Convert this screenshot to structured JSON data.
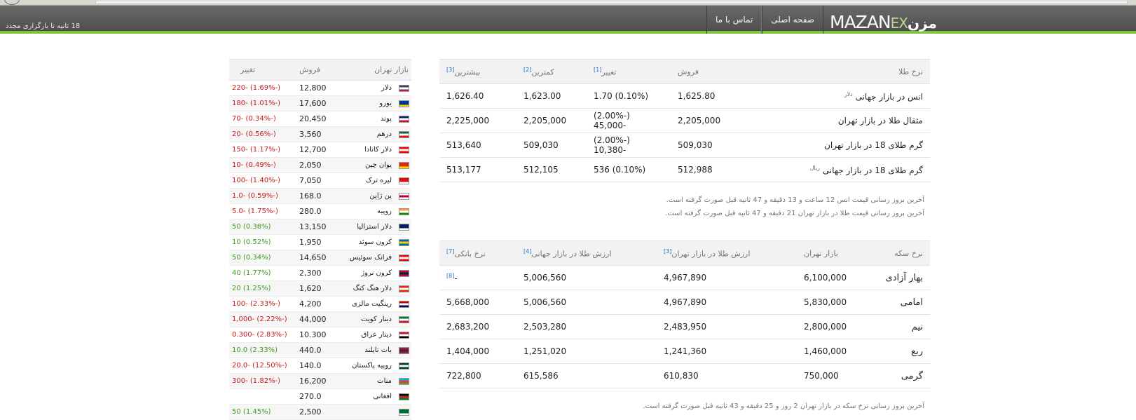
{
  "header": {
    "reload_text": "18 ثانیه تا بارگزاری مجدد",
    "logo": {
      "part1": "MAZAN",
      "part2": "EX",
      "part3": "مزن"
    },
    "nav": [
      {
        "label": "صفحه اصلی"
      },
      {
        "label": "تماس با ما"
      }
    ],
    "colors": {
      "bar": "#5a5a5a",
      "accent": "#7ec33d"
    }
  },
  "gold_table": {
    "headers": {
      "name": "نرخ طلا",
      "sell": "فروش",
      "change": "تغییر",
      "change_ref": "[1]",
      "min": "کمترین",
      "min_ref": "[2]",
      "max": "بیشترین",
      "max_ref": "[3]"
    },
    "rows": [
      {
        "name": "انس در بازار جهانی",
        "unit": "دلار",
        "sell": "1,625.80",
        "change": "(0.10%) 1.70",
        "dir": "pos",
        "min": "1,623.00",
        "max": "1,626.40"
      },
      {
        "name": "مثقال طلا در بازار تهران",
        "unit": "",
        "sell": "2,205,000",
        "change": "(-2.00%) -45,000",
        "dir": "neg",
        "min": "2,205,000",
        "max": "2,225,000"
      },
      {
        "name": "گرم طلای 18 در بازار تهران",
        "unit": "",
        "sell": "509,030",
        "change": "(-2.00%) -10,380",
        "dir": "neg",
        "min": "509,030",
        "max": "513,640"
      },
      {
        "name": "گرم طلای 18 در بازار جهانی",
        "unit": "ریال",
        "sell": "512,988",
        "change": "(0.10%) 536",
        "dir": "pos",
        "min": "512,105",
        "max": "513,177"
      }
    ],
    "notes": [
      "آخرین بروز رسانی قیمت انس 12 ساعت و 13 دقیقه و 47 ثانیه قبل صورت گرفته است.",
      "آخرین بروز رسانی قیمت طلا در بازار تهران 21 دقیقه و 47 ثانیه قبل صورت گرفته است."
    ]
  },
  "coin_table": {
    "headers": {
      "name": "نرخ سکه",
      "tehran": "بازار تهران",
      "gold_tehran": "ارزش طلا در بازار تهران",
      "gold_tehran_ref": "[3]",
      "gold_world": "ارزش طلا در بازار جهانی",
      "gold_world_ref": "[4]",
      "bank": "نرخ بانکی",
      "bank_ref": "[7]"
    },
    "rows": [
      {
        "name": "بهار آزادی",
        "tehran": "6,100,000",
        "gold_tehran": "4,967,890",
        "gold_world": "5,006,560",
        "bank": "-",
        "bank_ref": "[8]"
      },
      {
        "name": "امامی",
        "tehran": "5,830,000",
        "gold_tehran": "4,967,890",
        "gold_world": "5,006,560",
        "bank": "5,668,000",
        "bank_ref": ""
      },
      {
        "name": "نیم",
        "tehran": "2,800,000",
        "gold_tehran": "2,483,950",
        "gold_world": "2,503,280",
        "bank": "2,683,200",
        "bank_ref": ""
      },
      {
        "name": "ربع",
        "tehran": "1,460,000",
        "gold_tehran": "1,241,360",
        "gold_world": "1,251,020",
        "bank": "1,404,000",
        "bank_ref": ""
      },
      {
        "name": "گرمی",
        "tehran": "750,000",
        "gold_tehran": "610,830",
        "gold_world": "615,586",
        "bank": "722,800",
        "bank_ref": ""
      }
    ],
    "note": "آخرین بروز رسانی نرخ سکه در بازار تهران 2 روز و 25 دقیقه و 43 ثانیه قبل صورت گرفته است."
  },
  "currency_table": {
    "headers": {
      "market": "بازار تهران",
      "sell": "فروش",
      "change": "تغییر"
    },
    "rows": [
      {
        "name": "دلار",
        "sell": "12,800",
        "change": "(-1.69%) -220",
        "dir": "neg",
        "flag": [
          "#3c3b6e",
          "#ffffff",
          "#b22234"
        ]
      },
      {
        "name": "یورو",
        "sell": "17,600",
        "change": "(-1.01%) -180",
        "dir": "neg",
        "flag": [
          "#003399",
          "#003399",
          "#ffcc00"
        ]
      },
      {
        "name": "پوند",
        "sell": "20,450",
        "change": "(-0.34%) -70",
        "dir": "neg",
        "flag": [
          "#012169",
          "#ffffff",
          "#c8102e"
        ]
      },
      {
        "name": "درهم",
        "sell": "3,560",
        "change": "(-0.56%) -20",
        "dir": "neg",
        "flag": [
          "#00732f",
          "#ffffff",
          "#ff0000"
        ]
      },
      {
        "name": "دلار کانادا",
        "sell": "12,700",
        "change": "(-1.17%) -150",
        "dir": "neg",
        "flag": [
          "#ff0000",
          "#ffffff",
          "#ff0000"
        ]
      },
      {
        "name": "یوان چین",
        "sell": "2,050",
        "change": "(-0.49%) -10",
        "dir": "neg",
        "flag": [
          "#de2910",
          "#de2910",
          "#ffde00"
        ]
      },
      {
        "name": "لیره ترک",
        "sell": "7,050",
        "change": "(-1.40%) -100",
        "dir": "neg",
        "flag": [
          "#e30a17",
          "#e30a17",
          "#ffffff"
        ]
      },
      {
        "name": "ین ژاپن",
        "sell": "168.0",
        "change": "(-0.59%) -1.0",
        "dir": "neg",
        "flag": [
          "#ffffff",
          "#bc002d",
          "#ffffff"
        ]
      },
      {
        "name": "روپیه",
        "sell": "280.0",
        "change": "(-1.75%) -5.0",
        "dir": "neg",
        "flag": [
          "#ff9933",
          "#ffffff",
          "#138808"
        ]
      },
      {
        "name": "دلار استرالیا",
        "sell": "13,150",
        "change": "(0.38%) 50",
        "dir": "pos",
        "flag": [
          "#012169",
          "#012169",
          "#ffffff"
        ]
      },
      {
        "name": "کرون سوئد",
        "sell": "1,950",
        "change": "(0.52%) 10",
        "dir": "pos",
        "flag": [
          "#006aa7",
          "#fecc00",
          "#006aa7"
        ]
      },
      {
        "name": "فرانک سوئیس",
        "sell": "14,650",
        "change": "(0.34%) 50",
        "dir": "pos",
        "flag": [
          "#ff0000",
          "#ffffff",
          "#ff0000"
        ]
      },
      {
        "name": "کرون نروژ",
        "sell": "2,300",
        "change": "(1.77%) 40",
        "dir": "pos",
        "flag": [
          "#ba0c2f",
          "#00205b",
          "#ba0c2f"
        ]
      },
      {
        "name": "دلار هنگ کنگ",
        "sell": "1,620",
        "change": "(1.25%) 20",
        "dir": "pos",
        "flag": [
          "#de2910",
          "#ffffff",
          "#de2910"
        ]
      },
      {
        "name": "رینگیت مالزی",
        "sell": "4,200",
        "change": "(-2.33%) -100",
        "dir": "neg",
        "flag": [
          "#cc0001",
          "#ffffff",
          "#010066"
        ]
      },
      {
        "name": "دینار کویت",
        "sell": "44,000",
        "change": "(-2.22%) -1,000",
        "dir": "neg",
        "flag": [
          "#007a3d",
          "#ffffff",
          "#ce1126"
        ]
      },
      {
        "name": "دینار عراق",
        "sell": "10.300",
        "change": "(-2.83%) -0.300",
        "dir": "neg",
        "flag": [
          "#ce1126",
          "#ffffff",
          "#000000"
        ]
      },
      {
        "name": "بات تایلند",
        "sell": "440.0",
        "change": "(2.33%) 10.0",
        "dir": "pos",
        "flag": [
          "#a51931",
          "#2d2a4a",
          "#a51931"
        ]
      },
      {
        "name": "روپیه پاکستان",
        "sell": "140.0",
        "change": "(-12.50%) -20.0",
        "dir": "neg",
        "flag": [
          "#01411c",
          "#ffffff",
          "#01411c"
        ]
      },
      {
        "name": "منات",
        "sell": "16,200",
        "change": "(-1.82%) -300",
        "dir": "neg",
        "flag": [
          "#00b5e2",
          "#ef3340",
          "#509e2f"
        ]
      },
      {
        "name": "افغانی",
        "sell": "270.0",
        "change": "",
        "dir": "",
        "flag": [
          "#000000",
          "#d32011",
          "#007a36"
        ]
      },
      {
        "name": "",
        "sell": "2,500",
        "change": "(1.45%) 50",
        "dir": "pos",
        "flag": [
          "#006c35",
          "#006c35",
          "#ffffff"
        ]
      }
    ]
  }
}
